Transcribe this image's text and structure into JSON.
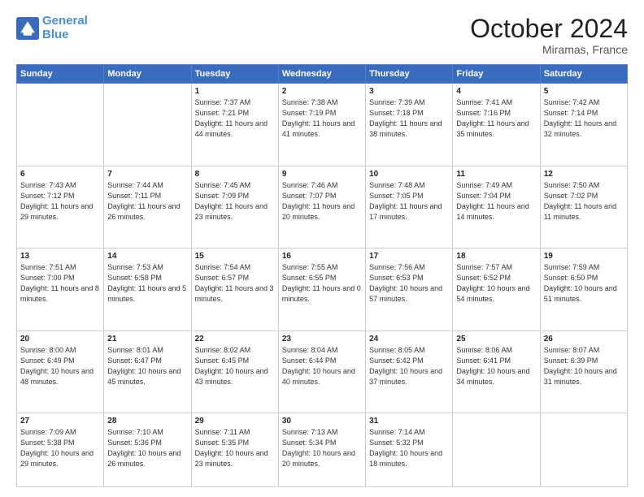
{
  "logo": {
    "line1": "General",
    "line2": "Blue"
  },
  "header": {
    "month": "October 2024",
    "location": "Miramas, France"
  },
  "weekdays": [
    "Sunday",
    "Monday",
    "Tuesday",
    "Wednesday",
    "Thursday",
    "Friday",
    "Saturday"
  ],
  "weeks": [
    [
      {
        "day": "",
        "sunrise": "",
        "sunset": "",
        "daylight": "",
        "empty": true
      },
      {
        "day": "",
        "sunrise": "",
        "sunset": "",
        "daylight": "",
        "empty": true
      },
      {
        "day": "1",
        "sunrise": "Sunrise: 7:37 AM",
        "sunset": "Sunset: 7:21 PM",
        "daylight": "Daylight: 11 hours and 44 minutes."
      },
      {
        "day": "2",
        "sunrise": "Sunrise: 7:38 AM",
        "sunset": "Sunset: 7:19 PM",
        "daylight": "Daylight: 11 hours and 41 minutes."
      },
      {
        "day": "3",
        "sunrise": "Sunrise: 7:39 AM",
        "sunset": "Sunset: 7:18 PM",
        "daylight": "Daylight: 11 hours and 38 minutes."
      },
      {
        "day": "4",
        "sunrise": "Sunrise: 7:41 AM",
        "sunset": "Sunset: 7:16 PM",
        "daylight": "Daylight: 11 hours and 35 minutes."
      },
      {
        "day": "5",
        "sunrise": "Sunrise: 7:42 AM",
        "sunset": "Sunset: 7:14 PM",
        "daylight": "Daylight: 11 hours and 32 minutes."
      }
    ],
    [
      {
        "day": "6",
        "sunrise": "Sunrise: 7:43 AM",
        "sunset": "Sunset: 7:12 PM",
        "daylight": "Daylight: 11 hours and 29 minutes."
      },
      {
        "day": "7",
        "sunrise": "Sunrise: 7:44 AM",
        "sunset": "Sunset: 7:11 PM",
        "daylight": "Daylight: 11 hours and 26 minutes."
      },
      {
        "day": "8",
        "sunrise": "Sunrise: 7:45 AM",
        "sunset": "Sunset: 7:09 PM",
        "daylight": "Daylight: 11 hours and 23 minutes."
      },
      {
        "day": "9",
        "sunrise": "Sunrise: 7:46 AM",
        "sunset": "Sunset: 7:07 PM",
        "daylight": "Daylight: 11 hours and 20 minutes."
      },
      {
        "day": "10",
        "sunrise": "Sunrise: 7:48 AM",
        "sunset": "Sunset: 7:05 PM",
        "daylight": "Daylight: 11 hours and 17 minutes."
      },
      {
        "day": "11",
        "sunrise": "Sunrise: 7:49 AM",
        "sunset": "Sunset: 7:04 PM",
        "daylight": "Daylight: 11 hours and 14 minutes."
      },
      {
        "day": "12",
        "sunrise": "Sunrise: 7:50 AM",
        "sunset": "Sunset: 7:02 PM",
        "daylight": "Daylight: 11 hours and 11 minutes."
      }
    ],
    [
      {
        "day": "13",
        "sunrise": "Sunrise: 7:51 AM",
        "sunset": "Sunset: 7:00 PM",
        "daylight": "Daylight: 11 hours and 8 minutes."
      },
      {
        "day": "14",
        "sunrise": "Sunrise: 7:53 AM",
        "sunset": "Sunset: 6:58 PM",
        "daylight": "Daylight: 11 hours and 5 minutes."
      },
      {
        "day": "15",
        "sunrise": "Sunrise: 7:54 AM",
        "sunset": "Sunset: 6:57 PM",
        "daylight": "Daylight: 11 hours and 3 minutes."
      },
      {
        "day": "16",
        "sunrise": "Sunrise: 7:55 AM",
        "sunset": "Sunset: 6:55 PM",
        "daylight": "Daylight: 11 hours and 0 minutes."
      },
      {
        "day": "17",
        "sunrise": "Sunrise: 7:56 AM",
        "sunset": "Sunset: 6:53 PM",
        "daylight": "Daylight: 10 hours and 57 minutes."
      },
      {
        "day": "18",
        "sunrise": "Sunrise: 7:57 AM",
        "sunset": "Sunset: 6:52 PM",
        "daylight": "Daylight: 10 hours and 54 minutes."
      },
      {
        "day": "19",
        "sunrise": "Sunrise: 7:59 AM",
        "sunset": "Sunset: 6:50 PM",
        "daylight": "Daylight: 10 hours and 51 minutes."
      }
    ],
    [
      {
        "day": "20",
        "sunrise": "Sunrise: 8:00 AM",
        "sunset": "Sunset: 6:49 PM",
        "daylight": "Daylight: 10 hours and 48 minutes."
      },
      {
        "day": "21",
        "sunrise": "Sunrise: 8:01 AM",
        "sunset": "Sunset: 6:47 PM",
        "daylight": "Daylight: 10 hours and 45 minutes."
      },
      {
        "day": "22",
        "sunrise": "Sunrise: 8:02 AM",
        "sunset": "Sunset: 6:45 PM",
        "daylight": "Daylight: 10 hours and 43 minutes."
      },
      {
        "day": "23",
        "sunrise": "Sunrise: 8:04 AM",
        "sunset": "Sunset: 6:44 PM",
        "daylight": "Daylight: 10 hours and 40 minutes."
      },
      {
        "day": "24",
        "sunrise": "Sunrise: 8:05 AM",
        "sunset": "Sunset: 6:42 PM",
        "daylight": "Daylight: 10 hours and 37 minutes."
      },
      {
        "day": "25",
        "sunrise": "Sunrise: 8:06 AM",
        "sunset": "Sunset: 6:41 PM",
        "daylight": "Daylight: 10 hours and 34 minutes."
      },
      {
        "day": "26",
        "sunrise": "Sunrise: 8:07 AM",
        "sunset": "Sunset: 6:39 PM",
        "daylight": "Daylight: 10 hours and 31 minutes."
      }
    ],
    [
      {
        "day": "27",
        "sunrise": "Sunrise: 7:09 AM",
        "sunset": "Sunset: 5:38 PM",
        "daylight": "Daylight: 10 hours and 29 minutes."
      },
      {
        "day": "28",
        "sunrise": "Sunrise: 7:10 AM",
        "sunset": "Sunset: 5:36 PM",
        "daylight": "Daylight: 10 hours and 26 minutes."
      },
      {
        "day": "29",
        "sunrise": "Sunrise: 7:11 AM",
        "sunset": "Sunset: 5:35 PM",
        "daylight": "Daylight: 10 hours and 23 minutes."
      },
      {
        "day": "30",
        "sunrise": "Sunrise: 7:13 AM",
        "sunset": "Sunset: 5:34 PM",
        "daylight": "Daylight: 10 hours and 20 minutes."
      },
      {
        "day": "31",
        "sunrise": "Sunrise: 7:14 AM",
        "sunset": "Sunset: 5:32 PM",
        "daylight": "Daylight: 10 hours and 18 minutes."
      },
      {
        "day": "",
        "sunrise": "",
        "sunset": "",
        "daylight": "",
        "empty": true
      },
      {
        "day": "",
        "sunrise": "",
        "sunset": "",
        "daylight": "",
        "empty": true
      }
    ]
  ]
}
